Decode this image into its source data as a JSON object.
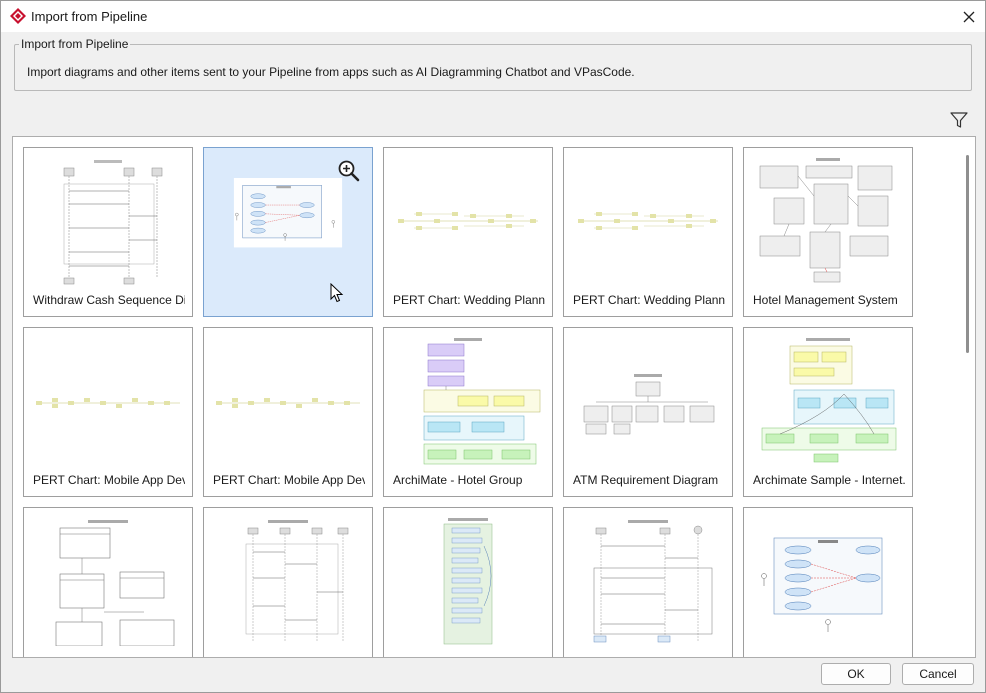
{
  "window": {
    "title": "Import from Pipeline",
    "close_icon": "close-icon",
    "app_icon": "visual-paradigm-logo-icon"
  },
  "group": {
    "legend": "Import from Pipeline",
    "description": "Import diagrams and other items sent to your Pipeline from apps such as AI Diagramming Chatbot and VPasCode."
  },
  "toolbar": {
    "filter_icon": "filter-icon"
  },
  "diagrams": [
    {
      "label": "Withdraw Cash Sequence Di...",
      "kind": "sequence",
      "selected": false
    },
    {
      "label": "",
      "kind": "usecase",
      "selected": true
    },
    {
      "label": "PERT Chart: Wedding Planning",
      "kind": "pert",
      "selected": false
    },
    {
      "label": "PERT Chart: Wedding Planning",
      "kind": "pert",
      "selected": false
    },
    {
      "label": "Hotel Management System",
      "kind": "class",
      "selected": false
    },
    {
      "label": "PERT Chart: Mobile App Dev...",
      "kind": "pert",
      "selected": false
    },
    {
      "label": "PERT Chart: Mobile App Dev...",
      "kind": "pert",
      "selected": false
    },
    {
      "label": "ArchiMate - Hotel Group",
      "kind": "archimate",
      "selected": false
    },
    {
      "label": "ATM Requirement Diagram",
      "kind": "requirement",
      "selected": false
    },
    {
      "label": "Archimate Sample - Internet...",
      "kind": "archimate2",
      "selected": false
    },
    {
      "label": "",
      "kind": "erd",
      "selected": false
    },
    {
      "label": "",
      "kind": "sequence2",
      "selected": false
    },
    {
      "label": "",
      "kind": "activity",
      "selected": false
    },
    {
      "label": "",
      "kind": "sequence3",
      "selected": false
    },
    {
      "label": "",
      "kind": "usecase2",
      "selected": false
    }
  ],
  "buttons": {
    "ok": "OK",
    "cancel": "Cancel"
  },
  "colors": {
    "selection": "#dbeafb",
    "accent": "#c8102e"
  }
}
